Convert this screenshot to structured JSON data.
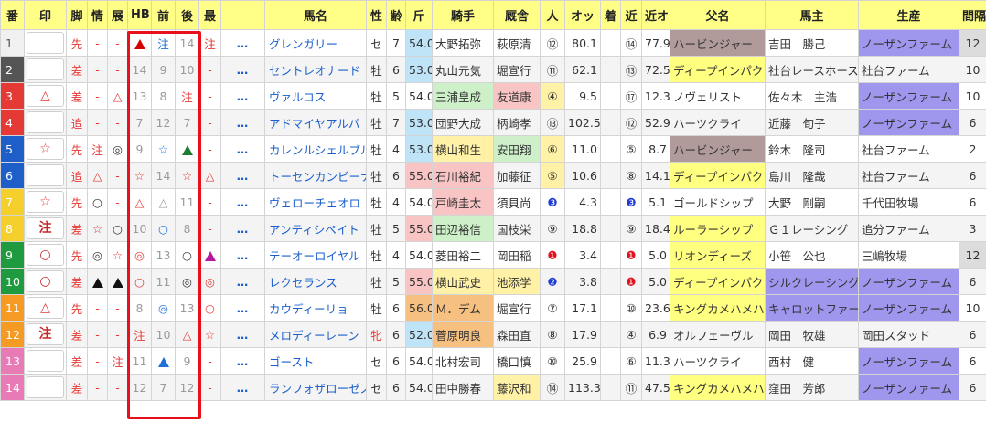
{
  "colors": {
    "frame_1": "#f0f0f0",
    "frame_2": "#555555",
    "frame_3": "#e53935",
    "frame_4": "#e53935",
    "frame_5": "#1e5ec8",
    "frame_6": "#1e5ec8",
    "frame_7": "#f5d02c",
    "frame_8": "#f5d02c",
    "frame_9": "#1f9a3e",
    "frame_10": "#1f9a3e",
    "frame_11": "#f59a23",
    "frame_12": "#f59a23",
    "frame_13": "#e87bb5",
    "frame_14": "#e87bb5",
    "weight_light_blue": "#bfe3f7",
    "weight_pink": "#f8c4c4",
    "weight_orange": "#f6c080",
    "jockey_green": "#cdf0c9",
    "jockey_pink": "#f8c4c4",
    "jockey_yellow": "#fff2a6",
    "jockey_orange": "#f6c080",
    "sire_gray": "#b09a9a",
    "sire_yellow": "#ffff80",
    "owner_purple": "#9f96ee",
    "breeder_purple": "#9f96ee",
    "interval_gray": "#dcdcdc",
    "hb_highlight": "#e8101a"
  },
  "headers": {
    "num": "番",
    "mark": "印",
    "leg": "脚",
    "info": "情",
    "dev": "展",
    "hb": "HB",
    "prev": "前",
    "after": "後",
    "last": "最",
    "dots": "",
    "horse": "馬名",
    "sex": "性",
    "age": "齢",
    "weight": "斤",
    "jockey": "騎手",
    "trainer": "厩舎",
    "pop": "人",
    "odds": "オッ",
    "finish": "着",
    "recent": "近",
    "recent_odds": "近オ",
    "sire": "父名",
    "owner": "馬主",
    "breeder": "生産",
    "interval": "間隔"
  },
  "rows": [
    {
      "num": "1",
      "mark": "",
      "leg": "先",
      "info": "-",
      "dev": "-",
      "hb": "▲",
      "prev": "注",
      "after": "14",
      "last": "注",
      "dots": "…",
      "horse": "グレンガリー",
      "sex": "セ",
      "age": "7",
      "weight": "54.0",
      "jockey": "大野拓弥",
      "trainer": "萩原清",
      "pop": "⑫",
      "odds": "80.1",
      "finish": "",
      "recent": "⑭",
      "recent_odds": "77.9",
      "sire": "ハービンジャー",
      "owner": "吉田　勝己",
      "breeder": "ノーザンファーム",
      "interval": "12"
    },
    {
      "num": "2",
      "mark": "",
      "leg": "差",
      "info": "-",
      "dev": "-",
      "hb": "14",
      "prev": "9",
      "after": "10",
      "last": "-",
      "dots": "…",
      "horse": "セントレオナード",
      "sex": "牡",
      "age": "6",
      "weight": "53.0",
      "jockey": "丸山元気",
      "trainer": "堀宣行",
      "pop": "⑪",
      "odds": "62.1",
      "finish": "",
      "recent": "⑬",
      "recent_odds": "72.5",
      "sire": "ディープインパクト",
      "owner": "社台レースホース",
      "breeder": "社台ファーム",
      "interval": "10"
    },
    {
      "num": "3",
      "mark": "△",
      "leg": "差",
      "info": "-",
      "dev": "△",
      "hb": "13",
      "prev": "8",
      "after": "注",
      "last": "-",
      "dots": "…",
      "horse": "ヴァルコス",
      "sex": "牡",
      "age": "5",
      "weight": "54.0",
      "jockey": "三浦皇成",
      "trainer": "友道康",
      "pop": "④",
      "odds": "9.5",
      "finish": "",
      "recent": "⑰",
      "recent_odds": "12.3",
      "sire": "ノヴェリスト",
      "owner": "佐々木　主浩",
      "breeder": "ノーザンファーム",
      "interval": "10"
    },
    {
      "num": "4",
      "mark": "",
      "leg": "追",
      "info": "-",
      "dev": "-",
      "hb": "7",
      "prev": "12",
      "after": "7",
      "last": "-",
      "dots": "…",
      "horse": "アドマイヤアルバ",
      "sex": "牡",
      "age": "7",
      "weight": "53.0",
      "jockey": "団野大成",
      "trainer": "柄崎孝",
      "pop": "⑬",
      "odds": "102.5",
      "finish": "",
      "recent": "⑫",
      "recent_odds": "52.9",
      "sire": "ハーツクライ",
      "owner": "近藤　旬子",
      "breeder": "ノーザンファーム",
      "interval": "6"
    },
    {
      "num": "5",
      "mark": "☆",
      "leg": "先",
      "info": "注",
      "dev": "◎",
      "hb": "9",
      "prev": "☆",
      "after": "▲",
      "last": "-",
      "dots": "…",
      "horse": "カレンルシェルブル",
      "sex": "牡",
      "age": "4",
      "weight": "53.0",
      "jockey": "横山和生",
      "trainer": "安田翔",
      "pop": "⑥",
      "odds": "11.0",
      "finish": "",
      "recent": "⑤",
      "recent_odds": "8.7",
      "sire": "ハービンジャー",
      "owner": "鈴木　隆司",
      "breeder": "社台ファーム",
      "interval": "2"
    },
    {
      "num": "6",
      "mark": "",
      "leg": "追",
      "info": "△",
      "dev": "-",
      "hb": "☆",
      "prev": "14",
      "after": "☆",
      "last": "△",
      "dots": "…",
      "horse": "トーセンカンビーナ",
      "sex": "牡",
      "age": "6",
      "weight": "55.0",
      "jockey": "石川裕紀",
      "trainer": "加藤征",
      "pop": "⑤",
      "odds": "10.6",
      "finish": "",
      "recent": "⑧",
      "recent_odds": "14.1",
      "sire": "ディープインパクト",
      "owner": "島川　隆哉",
      "breeder": "社台ファーム",
      "interval": "6"
    },
    {
      "num": "7",
      "mark": "☆",
      "leg": "先",
      "info": "○",
      "dev": "-",
      "hb": "△",
      "prev": "△",
      "after": "11",
      "last": "-",
      "dots": "…",
      "horse": "ヴェローチェオロ",
      "sex": "牡",
      "age": "4",
      "weight": "54.0",
      "jockey": "戸崎圭太",
      "trainer": "須貝尚",
      "pop": "❸",
      "odds": "4.3",
      "finish": "",
      "recent": "❸",
      "recent_odds": "5.1",
      "sire": "ゴールドシップ",
      "owner": "大野　剛嗣",
      "breeder": "千代田牧場",
      "interval": "6"
    },
    {
      "num": "8",
      "mark": "注",
      "leg": "差",
      "info": "☆",
      "dev": "○",
      "hb": "10",
      "prev": "○",
      "after": "8",
      "last": "-",
      "dots": "…",
      "horse": "アンティシペイト",
      "sex": "牡",
      "age": "5",
      "weight": "55.0",
      "jockey": "田辺裕信",
      "trainer": "国枝栄",
      "pop": "⑨",
      "odds": "18.8",
      "finish": "",
      "recent": "⑨",
      "recent_odds": "18.4",
      "sire": "ルーラーシップ",
      "owner": "Ｇ１レーシング",
      "breeder": "追分ファーム",
      "interval": "3"
    },
    {
      "num": "9",
      "mark": "○",
      "leg": "先",
      "info": "◎",
      "dev": "☆",
      "hb": "◎",
      "prev": "13",
      "after": "○",
      "last": "▲",
      "dots": "…",
      "horse": "テーオーロイヤル",
      "sex": "牡",
      "age": "4",
      "weight": "54.0",
      "jockey": "菱田裕二",
      "trainer": "岡田稲",
      "pop": "❶",
      "odds": "3.4",
      "finish": "",
      "recent": "❶",
      "recent_odds": "5.0",
      "sire": "リオンディーズ",
      "owner": "小笹　公也",
      "breeder": "三嶋牧場",
      "interval": "12"
    },
    {
      "num": "10",
      "mark": "○",
      "leg": "差",
      "info": "▲",
      "dev": "▲",
      "hb": "○",
      "prev": "11",
      "after": "◎",
      "last": "◎",
      "dots": "…",
      "horse": "レクセランス",
      "sex": "牡",
      "age": "5",
      "weight": "55.0",
      "jockey": "横山武史",
      "trainer": "池添学",
      "pop": "❷",
      "odds": "3.8",
      "finish": "",
      "recent": "❶",
      "recent_odds": "5.0",
      "sire": "ディープインパクト",
      "owner": "シルクレーシング",
      "breeder": "ノーザンファーム",
      "interval": "6"
    },
    {
      "num": "11",
      "mark": "△",
      "leg": "先",
      "info": "-",
      "dev": "-",
      "hb": "8",
      "prev": "◎",
      "after": "13",
      "last": "○",
      "dots": "…",
      "horse": "カウディーリョ",
      "sex": "牡",
      "age": "6",
      "weight": "56.0",
      "jockey": "Ｍ．デム",
      "trainer": "堀宣行",
      "pop": "⑦",
      "odds": "17.1",
      "finish": "",
      "recent": "⑩",
      "recent_odds": "23.6",
      "sire": "キングカメハメハ",
      "owner": "キャロットファーム",
      "breeder": "ノーザンファーム",
      "interval": "10"
    },
    {
      "num": "12",
      "mark": "注",
      "leg": "差",
      "info": "-",
      "dev": "-",
      "hb": "注",
      "prev": "10",
      "after": "△",
      "last": "☆",
      "dots": "…",
      "horse": "メロディーレーン",
      "sex": "牝",
      "age": "6",
      "weight": "52.0",
      "jockey": "菅原明良",
      "trainer": "森田直",
      "pop": "⑧",
      "odds": "17.9",
      "finish": "",
      "recent": "④",
      "recent_odds": "6.9",
      "sire": "オルフェーヴル",
      "owner": "岡田　牧雄",
      "breeder": "岡田スタッド",
      "interval": "6"
    },
    {
      "num": "13",
      "mark": "",
      "leg": "差",
      "info": "-",
      "dev": "注",
      "hb": "11",
      "prev": "▲",
      "after": "9",
      "last": "-",
      "dots": "…",
      "horse": "ゴースト",
      "sex": "セ",
      "age": "6",
      "weight": "54.0",
      "jockey": "北村宏司",
      "trainer": "橋口慎",
      "pop": "⑩",
      "odds": "25.9",
      "finish": "",
      "recent": "⑥",
      "recent_odds": "11.3",
      "sire": "ハーツクライ",
      "owner": "西村　健",
      "breeder": "ノーザンファーム",
      "interval": "6"
    },
    {
      "num": "14",
      "mark": "",
      "leg": "差",
      "info": "-",
      "dev": "-",
      "hb": "12",
      "prev": "7",
      "after": "12",
      "last": "-",
      "dots": "…",
      "horse": "ランフォザローゼス",
      "sex": "セ",
      "age": "6",
      "weight": "54.0",
      "jockey": "田中勝春",
      "trainer": "藤沢和",
      "pop": "⑭",
      "odds": "113.3",
      "finish": "",
      "recent": "⑪",
      "recent_odds": "47.5",
      "sire": "キングカメハメハ",
      "owner": "窪田　芳郎",
      "breeder": "ノーザンファーム",
      "interval": "6"
    }
  ]
}
